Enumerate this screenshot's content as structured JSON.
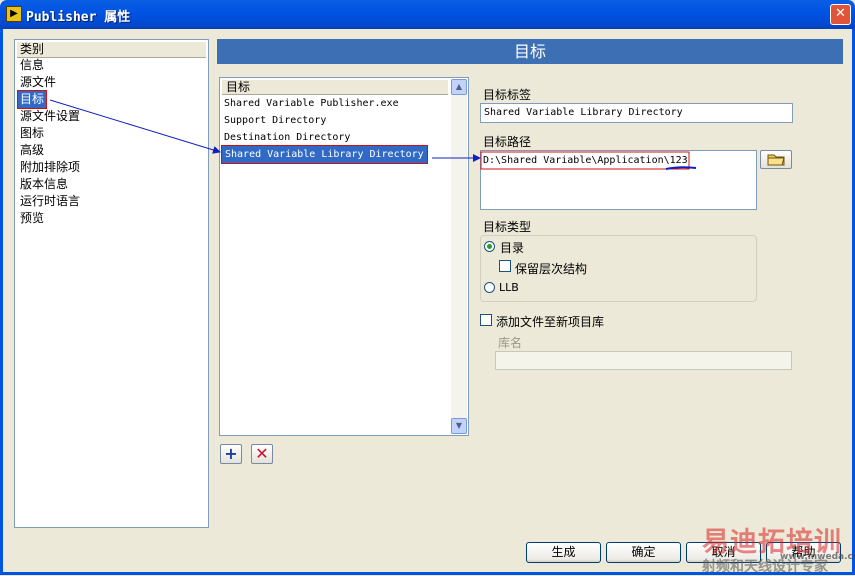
{
  "window": {
    "title": "Publisher 属性",
    "close_label": "✕",
    "app_icon": "▶"
  },
  "categories": {
    "header": "类别",
    "items": [
      "信息",
      "源文件",
      "目标",
      "源文件设置",
      "图标",
      "高级",
      "附加排除项",
      "版本信息",
      "运行时语言",
      "预览"
    ],
    "selected": "目标"
  },
  "banner": {
    "title": "目标"
  },
  "destinations": {
    "header": "目标",
    "items": [
      "Shared Variable Publisher.exe",
      "Support Directory",
      "Destination Directory",
      "Shared Variable Library Directory"
    ],
    "selected": "Shared Variable Library Directory",
    "add_label": "+",
    "remove_label": "✕"
  },
  "form": {
    "label_label": "目标标签",
    "label_value": "Shared Variable Library Directory",
    "path_label": "目标路径",
    "path_value_prefix": "D:\\Shared Variable\\Application\\",
    "path_value_suffix": "123",
    "browse_icon": "folder-icon",
    "type_label": "目标类型",
    "type_option_dir": "目录",
    "keep_hierarchy": "保留层次结构",
    "type_option_llb": "LLB",
    "type_selected": "目录",
    "add_to_new_lib": "添加文件至新项目库",
    "lib_name_label": "库名",
    "lib_name_value": ""
  },
  "buttons": {
    "build": "生成",
    "ok": "确定",
    "cancel": "取消",
    "help": "帮助"
  },
  "watermark": {
    "line1": "易迪拓培训",
    "line2": "射频和天线设计专家",
    "site": "www.mweda.com"
  },
  "colors": {
    "titlebar": "#0054e3",
    "banner": "#3c6fb3",
    "selection": "#316ac5",
    "annotation_red": "#d01010",
    "annotation_blue": "#1020c0"
  }
}
